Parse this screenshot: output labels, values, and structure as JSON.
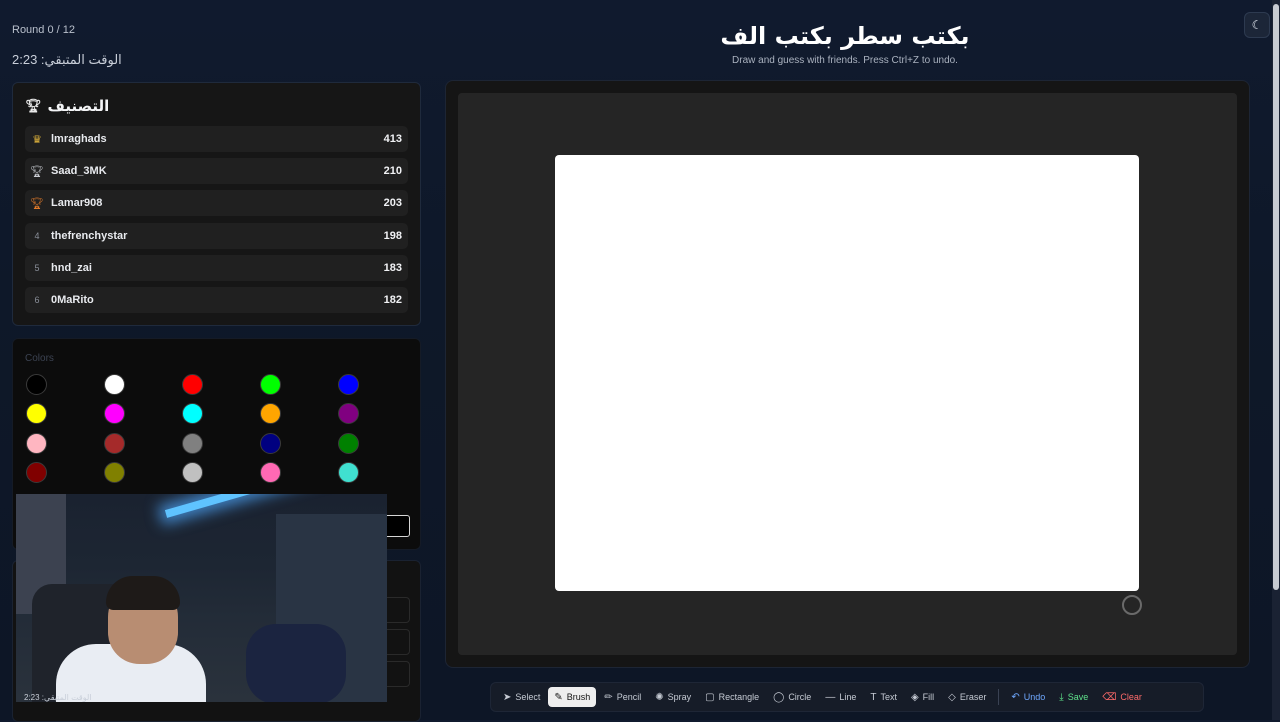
{
  "header": {
    "round": "Round 0 / 12",
    "timer": "الوقت المتبقي: 2:23",
    "title": "بكتب سطر بكتب الف",
    "subtitle": "Draw and guess with friends. Press Ctrl+Z to undo.",
    "theme_icon": "moon-icon"
  },
  "leaderboard": {
    "title": "التصنيف",
    "title_icon": "trophy-icon",
    "players": [
      {
        "rank": "",
        "icon": "crown-icon",
        "name": "lmraghads",
        "score": "413"
      },
      {
        "rank": "",
        "icon": "silver-trophy-icon",
        "name": "Saad_3MK",
        "score": "210"
      },
      {
        "rank": "",
        "icon": "bronze-trophy-icon",
        "name": "Lamar908",
        "score": "203"
      },
      {
        "rank": "4",
        "icon": "",
        "name": "thefrenchystar",
        "score": "198"
      },
      {
        "rank": "5",
        "icon": "",
        "name": "hnd_zai",
        "score": "183"
      },
      {
        "rank": "6",
        "icon": "",
        "name": "0MaRito",
        "score": "182"
      }
    ]
  },
  "palette": {
    "label": "Colors",
    "colors": [
      "#000000",
      "#ffffff",
      "#ff0000",
      "#00ff00",
      "#0000ff",
      "#ffff00",
      "#ff00ff",
      "#00ffff",
      "#ffa500",
      "#800080",
      "#ffb6c1",
      "#a52a2a",
      "#808080",
      "#000080",
      "#008000",
      "#800000",
      "#808000",
      "#c0c0c0",
      "#ff69b4",
      "#40e0d0"
    ]
  },
  "webcam": {
    "caption": "الوقت المتبقي: 2:23"
  },
  "toolbar": {
    "tools": [
      {
        "label": "Select",
        "icon": "cursor-icon",
        "glyph": "➤"
      },
      {
        "label": "Brush",
        "icon": "brush-icon",
        "glyph": "✎"
      },
      {
        "label": "Pencil",
        "icon": "pencil-icon",
        "glyph": "✏"
      },
      {
        "label": "Spray",
        "icon": "spray-icon",
        "glyph": "✺"
      },
      {
        "label": "Rectangle",
        "icon": "rectangle-icon",
        "glyph": "▢"
      },
      {
        "label": "Circle",
        "icon": "circle-icon",
        "glyph": "◯"
      },
      {
        "label": "Line",
        "icon": "line-icon",
        "glyph": "—"
      },
      {
        "label": "Text",
        "icon": "text-icon",
        "glyph": "T"
      },
      {
        "label": "Fill",
        "icon": "fill-bucket-icon",
        "glyph": "◈"
      },
      {
        "label": "Eraser",
        "icon": "eraser-icon",
        "glyph": "◇"
      }
    ],
    "active_tool": "Brush",
    "undo": {
      "label": "Undo",
      "icon": "undo-icon",
      "glyph": "↶"
    },
    "save": {
      "label": "Save",
      "icon": "download-icon",
      "glyph": "⤓"
    },
    "clear": {
      "label": "Clear",
      "icon": "trash-icon",
      "glyph": "🗑"
    }
  }
}
